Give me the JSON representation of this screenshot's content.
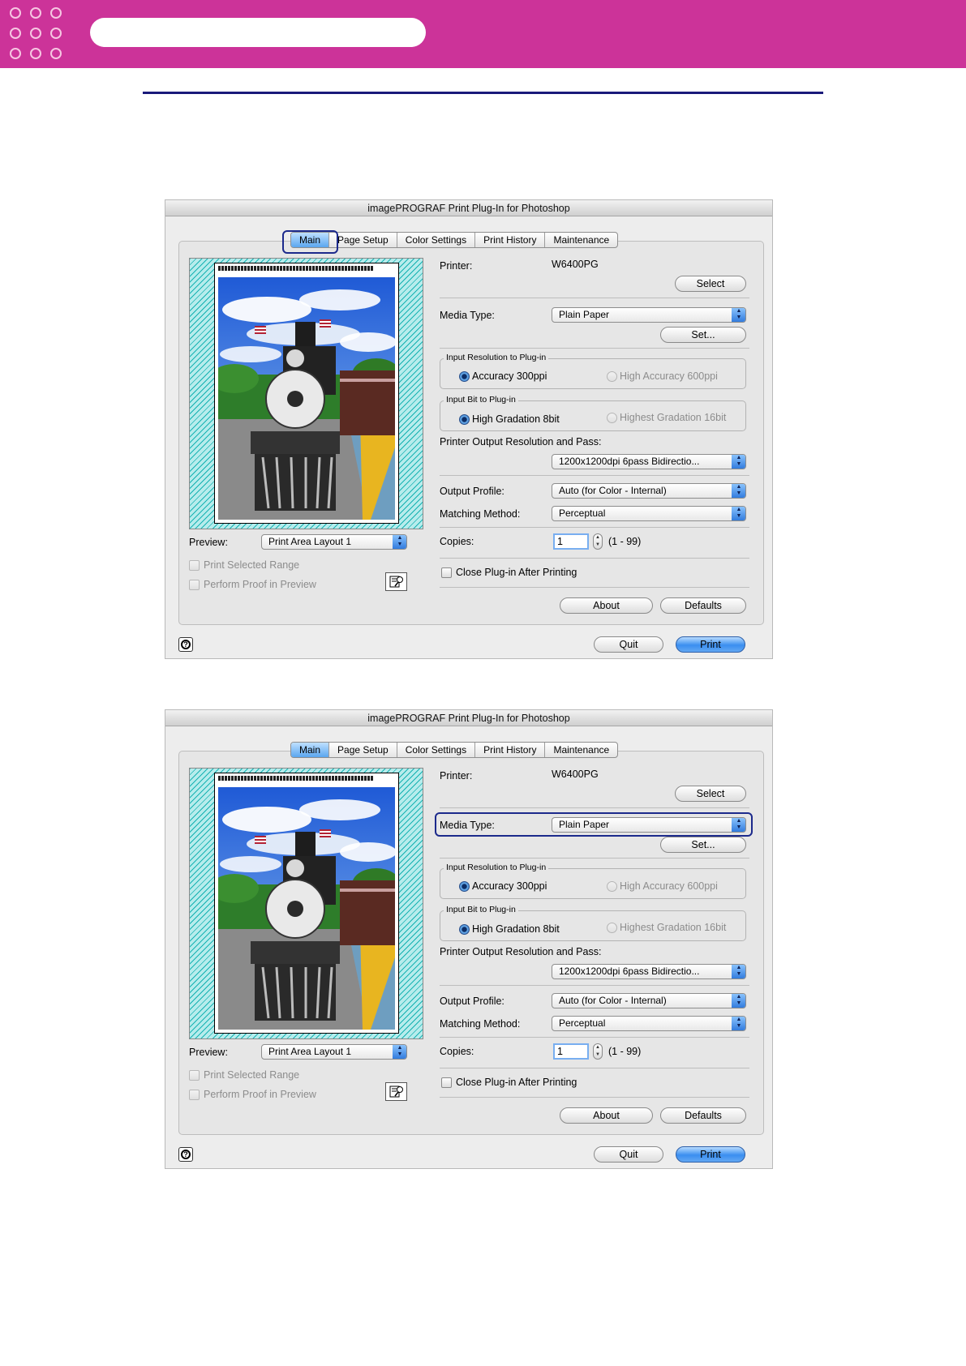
{
  "dialog": {
    "title": "imagePROGRAF Print Plug-In for Photoshop",
    "tabs": [
      "Main",
      "Page Setup",
      "Color Settings",
      "Print History",
      "Maintenance"
    ],
    "printer_label": "Printer:",
    "printer_value": "W6400PG",
    "select_button": "Select",
    "media_type_label": "Media Type:",
    "media_type_value": "Plain Paper",
    "set_button": "Set...",
    "input_resolution_group": "Input Resolution to Plug-in",
    "accuracy_300": "Accuracy 300ppi",
    "high_accuracy_600": "High Accuracy 600ppi",
    "input_bit_group": "Input Bit to Plug-in",
    "high_gradation_8": "High Gradation 8bit",
    "highest_gradation_16": "Highest Gradation 16bit",
    "output_resolution_label": "Printer Output Resolution and Pass:",
    "output_resolution_value": "1200x1200dpi 6pass Bidirectio...",
    "output_profile_label": "Output Profile:",
    "output_profile_value": "Auto (for Color - Internal)",
    "matching_method_label": "Matching Method:",
    "matching_method_value": "Perceptual",
    "copies_label": "Copies:",
    "copies_value": "1",
    "copies_range": "(1 - 99)",
    "close_after_printing": "Close Plug-in After Printing",
    "about_button": "About",
    "defaults_button": "Defaults",
    "preview_label": "Preview:",
    "preview_value": "Print Area Layout 1",
    "print_selected_range": "Print Selected Range",
    "perform_proof": "Perform Proof in Preview",
    "quit_button": "Quit",
    "print_button": "Print"
  },
  "icons": [
    "popup-arrow-icon",
    "preview-settings-icon",
    "help-icon",
    "stepper-arrows-icon"
  ],
  "colors": {
    "header_magenta": "#cc3399",
    "header_rule": "#1a1a7a",
    "highlight_box": "#1c2a8c",
    "aqua_blue": "#3a8ef0",
    "preview_hatch": "#16b2b2"
  }
}
